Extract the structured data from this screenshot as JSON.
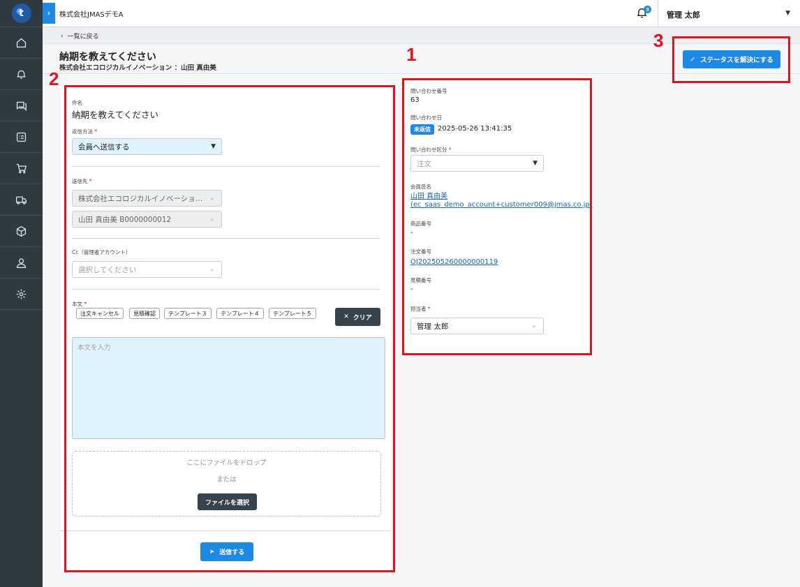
{
  "header": {
    "company": "株式会社JMASデモA",
    "notification_count": "3",
    "user_name": "管理 太郎"
  },
  "nav": [
    "home-icon",
    "bell-icon",
    "chat-icon",
    "list-icon",
    "cart-icon",
    "truck-icon",
    "box-icon",
    "user-icon",
    "gear-icon"
  ],
  "breadcrumb": {
    "back_label": "一覧に戻る"
  },
  "page": {
    "title": "納期を教えてください",
    "subtitle": "株式会社エコロジカルイノベーション ：山田 真由美",
    "resolve_label": "ステータスを解決にする"
  },
  "annotations": {
    "n1": "1",
    "n2": "2",
    "n3": "3"
  },
  "form": {
    "subject_label": "件名",
    "subject_value": "納期を教えてください",
    "send_method_label": "返信方法",
    "send_method_value": "会員へ送信する",
    "recipient_label": "送信先",
    "recipient_company": "株式会社エコロジカルイノベーショ…",
    "recipient_person": "山田 真由美 B0000000012",
    "cc_label": "Cc（管理者アカウント）",
    "cc_placeholder": "選択してください",
    "body_label": "本文",
    "templates": [
      "注文キャンセル",
      "見積確認",
      "テンプレート３",
      "テンプレート４",
      "テンプレート５"
    ],
    "clear_label": "クリア",
    "body_placeholder": "本文を入力",
    "drop_text": "ここにファイルをドロップ",
    "or_text": "または",
    "file_button": "ファイルを選択",
    "send_button": "送信する",
    "required_mark": "*"
  },
  "info": {
    "inquiry_no_label": "問い合わせ番号",
    "inquiry_no": "63",
    "inquiry_date_label": "問い合わせ日",
    "status_badge": "未返信",
    "inquiry_date": "2025-05-26 13:41:35",
    "category_label": "問い合わせ区分",
    "category_placeholder": "注文",
    "member_name_label": "会員氏名",
    "member_name": "山田 真由美",
    "member_email": "(ec_saas_demo_account+customer009@jmas.co.jp)",
    "product_no_label": "商品番号",
    "product_no": "-",
    "order_no_label": "注文番号",
    "order_no": "OJ202505260000000119",
    "quote_no_label": "見積番号",
    "quote_no": "-",
    "assignee_label": "担当者",
    "assignee": "管理 太郎"
  }
}
